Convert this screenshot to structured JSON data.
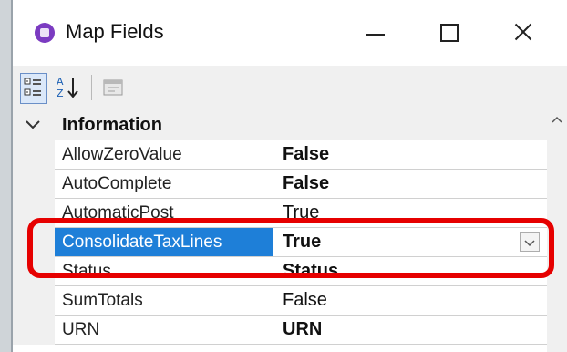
{
  "window": {
    "title": "Map Fields",
    "icon": "app-logo-icon",
    "controls": [
      "minimize-icon",
      "maximize-icon",
      "close-icon"
    ]
  },
  "toolbar": {
    "buttons": [
      "categorized-icon",
      "sort-alphabetical-icon",
      "property-pages-icon"
    ]
  },
  "grid": {
    "category": "Information",
    "properties": [
      {
        "name": "AllowZeroValue",
        "value": "False"
      },
      {
        "name": "AutoComplete",
        "value": "False"
      },
      {
        "name": "AutomaticPost",
        "value": "True"
      },
      {
        "name": "ConsolidateTaxLines",
        "value": "True"
      },
      {
        "name": "Status",
        "value": "Status"
      },
      {
        "name": "SumTotals",
        "value": "False"
      },
      {
        "name": "URN",
        "value": "URN"
      }
    ],
    "selected": "ConsolidateTaxLines"
  },
  "annotation": {
    "highlight_color": "#e60000"
  },
  "colors": {
    "selection": "#1e7fd8",
    "background": "#f0f0f0"
  }
}
